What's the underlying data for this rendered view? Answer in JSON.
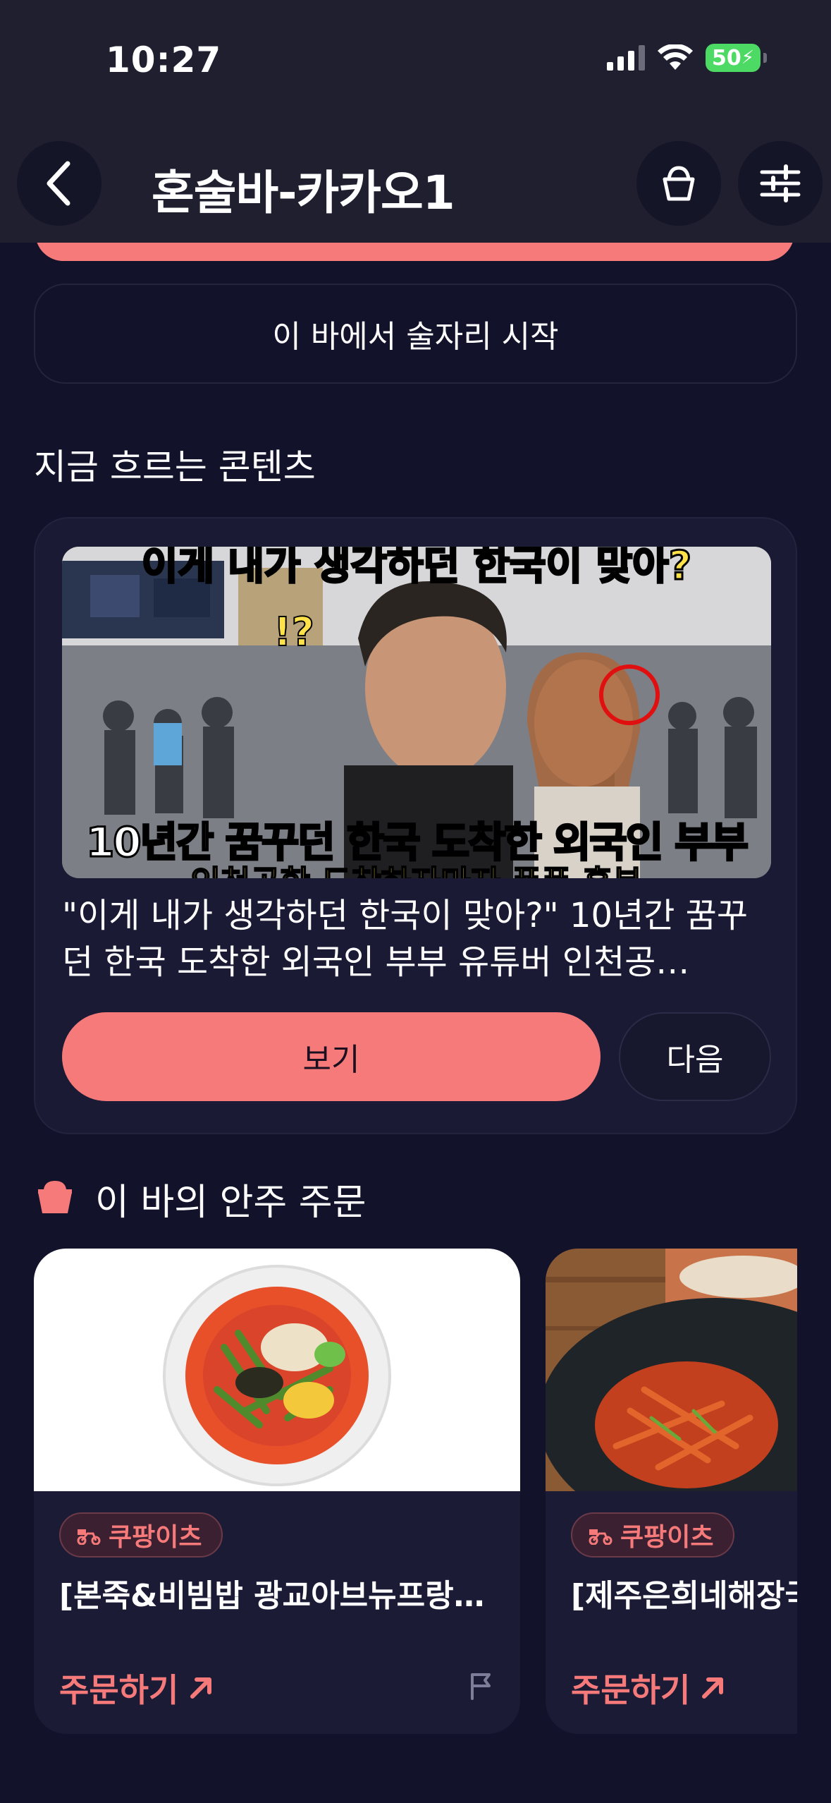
{
  "status_bar": {
    "time": "10:27",
    "battery": "50"
  },
  "header": {
    "title": "혼술바-카카오1",
    "back_icon": "chevron-left-icon",
    "store_icon": "snack-basket-icon",
    "settings_icon": "sliders-icon"
  },
  "start_button": {
    "label": "이 바에서 술자리 시작"
  },
  "content_section": {
    "title": "지금 흐르는 콘텐츠",
    "video": {
      "thumbnail_top_caption": "이게 내가 생각하던 한국이 맞아?",
      "thumbnail_main_caption": "10년간 꿈꾸던 한국 도착한 외국인 부부 유튜버",
      "thumbnail_bottom_caption": "인천공항 도착하자마자 폭풍 흥분",
      "title": "\"이게 내가 생각하던 한국이 맞아?\" 10년간 꿈꾸던 한국 도착한 외국인 부부 유튜버 인천공…",
      "watch_label": "보기",
      "next_label": "다음"
    }
  },
  "food_section": {
    "title": "이 바의 안주 주문",
    "items": [
      {
        "badge": "쿠팡이츠",
        "name": "[본죽&비빔밥 광교아브뉴프랑…",
        "order_label": "주문하기"
      },
      {
        "badge": "쿠팡이츠",
        "name": "[제주은희네해장국",
        "order_label": "주문하기"
      }
    ]
  },
  "colors": {
    "accent": "#f77a7a",
    "background": "#12122a",
    "card": "#1a1a34"
  }
}
